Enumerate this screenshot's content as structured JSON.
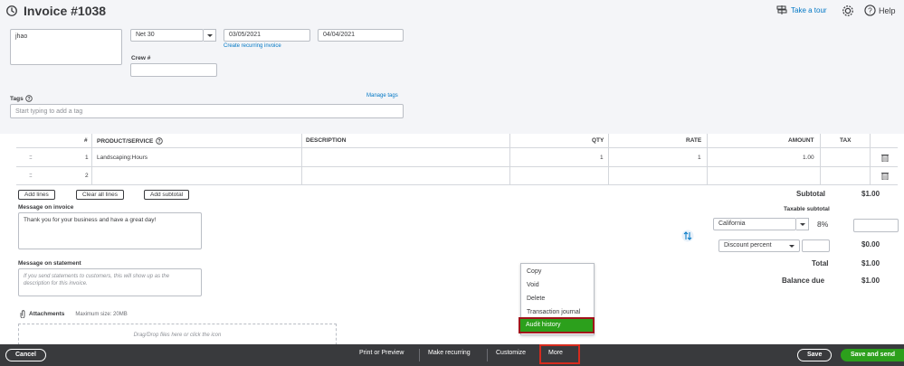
{
  "header": {
    "title": "Invoice #1038",
    "take_tour": "Take a tour",
    "help": "Help"
  },
  "form": {
    "address_value": "jhao",
    "terms_value": "Net 30",
    "invoice_date": "03/05/2021",
    "due_date": "04/04/2021",
    "create_recurring": "Create recurring invoice",
    "crew_label": "Crew #",
    "crew_value": "",
    "tags_label": "Tags",
    "manage_tags": "Manage tags",
    "tags_placeholder": "Start typing to add a tag"
  },
  "table": {
    "headers": {
      "num": "#",
      "product": "PRODUCT/SERVICE",
      "description": "DESCRIPTION",
      "qty": "QTY",
      "rate": "RATE",
      "amount": "AMOUNT",
      "tax": "TAX"
    },
    "rows": [
      {
        "num": "1",
        "product": "Landscaping:Hours",
        "description": "",
        "qty": "1",
        "rate": "1",
        "amount": "1.00"
      },
      {
        "num": "2",
        "product": "",
        "description": "",
        "qty": "",
        "rate": "",
        "amount": ""
      }
    ],
    "add_lines": "Add lines",
    "clear_all_lines": "Clear all lines",
    "add_subtotal": "Add subtotal"
  },
  "message": {
    "invoice_label": "Message on invoice",
    "invoice_value": "Thank you for your business and have a great day!",
    "statement_label": "Message on statement",
    "statement_placeholder": "If you send statements to customers, this will show up as the description for this invoice.",
    "attachments_label": "Attachments",
    "max_size": "Maximum size: 20MB",
    "dropzone": "Drag/Drop files here or click the icon"
  },
  "summary": {
    "subtotal_label": "Subtotal",
    "subtotal_value": "$1.00",
    "taxable_subtotal_label": "Taxable subtotal",
    "tax_region": "California",
    "tax_rate": "8%",
    "tax_amount": "",
    "discount_type": "Discount percent",
    "discount_value": "",
    "discount_amount": "$0.00",
    "total_label": "Total",
    "total_value": "$1.00",
    "balance_label": "Balance due",
    "balance_value": "$1.00"
  },
  "more_menu": {
    "items": [
      "Copy",
      "Void",
      "Delete",
      "Transaction journal"
    ],
    "highlighted": "Audit history"
  },
  "footer": {
    "cancel": "Cancel",
    "print_preview": "Print or Preview",
    "make_recurring": "Make recurring",
    "customize": "Customize",
    "more": "More",
    "save": "Save",
    "save_and_send": "Save and send"
  },
  "colors": {
    "link_blue": "#0077c5",
    "qb_green": "#2ca01c",
    "footer_bg": "#393a3d",
    "highlight_red": "#d52b1e"
  }
}
